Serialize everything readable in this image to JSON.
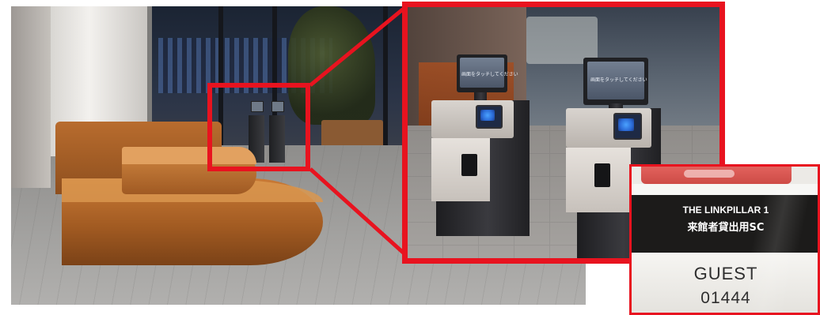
{
  "guest_card": {
    "title": "THE LINKPILLAR 1",
    "subtitle": "来館者貸出用SC",
    "label": "GUEST",
    "number": "01444"
  },
  "kiosks": {
    "left_display_text": "画面をタッチしてください",
    "right_display_text": "画面をタッチしてください"
  },
  "colors": {
    "highlight": "#e8131f",
    "wood": "#c97a36",
    "card_black": "#1c1b1a"
  }
}
